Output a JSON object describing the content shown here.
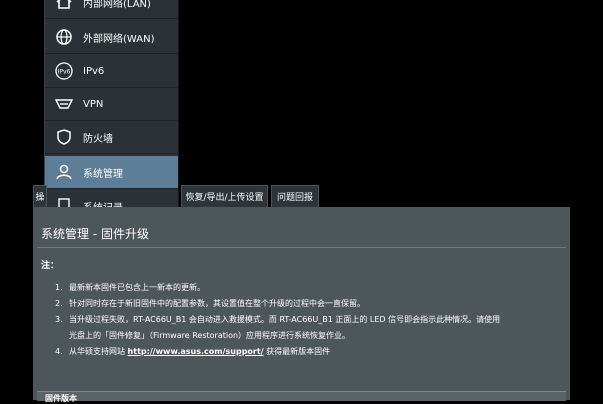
{
  "sidebar": {
    "items": [
      {
        "label": "内部网络(LAN)",
        "icon": "home-icon",
        "active": false
      },
      {
        "label": "外部网络(WAN)",
        "icon": "globe-icon",
        "active": false
      },
      {
        "label": "IPv6",
        "icon": "ipv6-icon",
        "active": false
      },
      {
        "label": "VPN",
        "icon": "vpn-icon",
        "active": false
      },
      {
        "label": "防火墙",
        "icon": "shield-icon",
        "active": false
      },
      {
        "label": "系统管理",
        "icon": "admin-user-icon",
        "active": true
      },
      {
        "label": "系统记录",
        "icon": "log-icon",
        "active": false
      }
    ]
  },
  "tabs": [
    {
      "label": "操"
    },
    {
      "label": "恢复/导出/上传设置"
    },
    {
      "label": "问题回报"
    }
  ],
  "content": {
    "title": "系统管理 - 固件升级",
    "note_label": "注：",
    "notes": [
      {
        "num": "1.",
        "text": "最新新本固件已包含上一新本的更新。"
      },
      {
        "num": "2.",
        "text": "针对同时存在于新旧固件中的配置参数，其设置值在整个升级的过程中会一直保留。"
      },
      {
        "num": "3.",
        "text": "当升级过程失败，RT-AC66U_B1 会自动进入救援模式。而 RT-AC66U_B1 正面上的 LED 信号即会指示此种情况。请使用"
      },
      {
        "num": "",
        "text": "光盘上的「固件修复」（Firmware Restoration）应用程序进行系统恢复作业。"
      },
      {
        "num": "4.",
        "text_before": "从华硕支持网站 ",
        "link": "http://www.asus.com/support/",
        "text_after": " 获得最新版本固件"
      }
    ],
    "table_header": "固件版本"
  }
}
